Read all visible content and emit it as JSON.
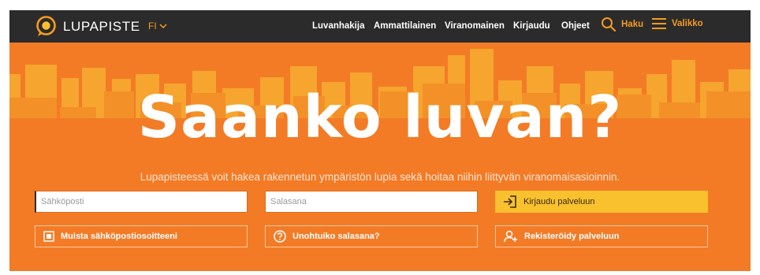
{
  "brand": {
    "name": "LUPAPISTE"
  },
  "language": {
    "selected": "FI"
  },
  "nav": {
    "items": [
      "Luvanhakija",
      "Ammattilainen",
      "Viranomainen",
      "Kirjaudu",
      "Ohjeet"
    ],
    "search_label": "Haku",
    "menu_label": "Valikko"
  },
  "hero": {
    "title": "Saanko luvan?",
    "subtitle": "Lupapisteessä voit hakea rakennetun ympäristön lupia sekä hoitaa niihin liittyvän viranomaisasioinnin."
  },
  "login": {
    "email_placeholder": "Sähköposti",
    "password_placeholder": "Salasana",
    "submit_label": "Kirjaudu palveluun",
    "remember_label": "Muista sähköpostiosoitteeni",
    "forgot_label": "Unohtuiko salasana?",
    "register_label": "Rekisteröidy palveluun"
  },
  "colors": {
    "navbar": "#2b2b2b",
    "accent": "#f59a23",
    "hero_bg": "#f37b26",
    "login_button": "#f9c12e"
  }
}
